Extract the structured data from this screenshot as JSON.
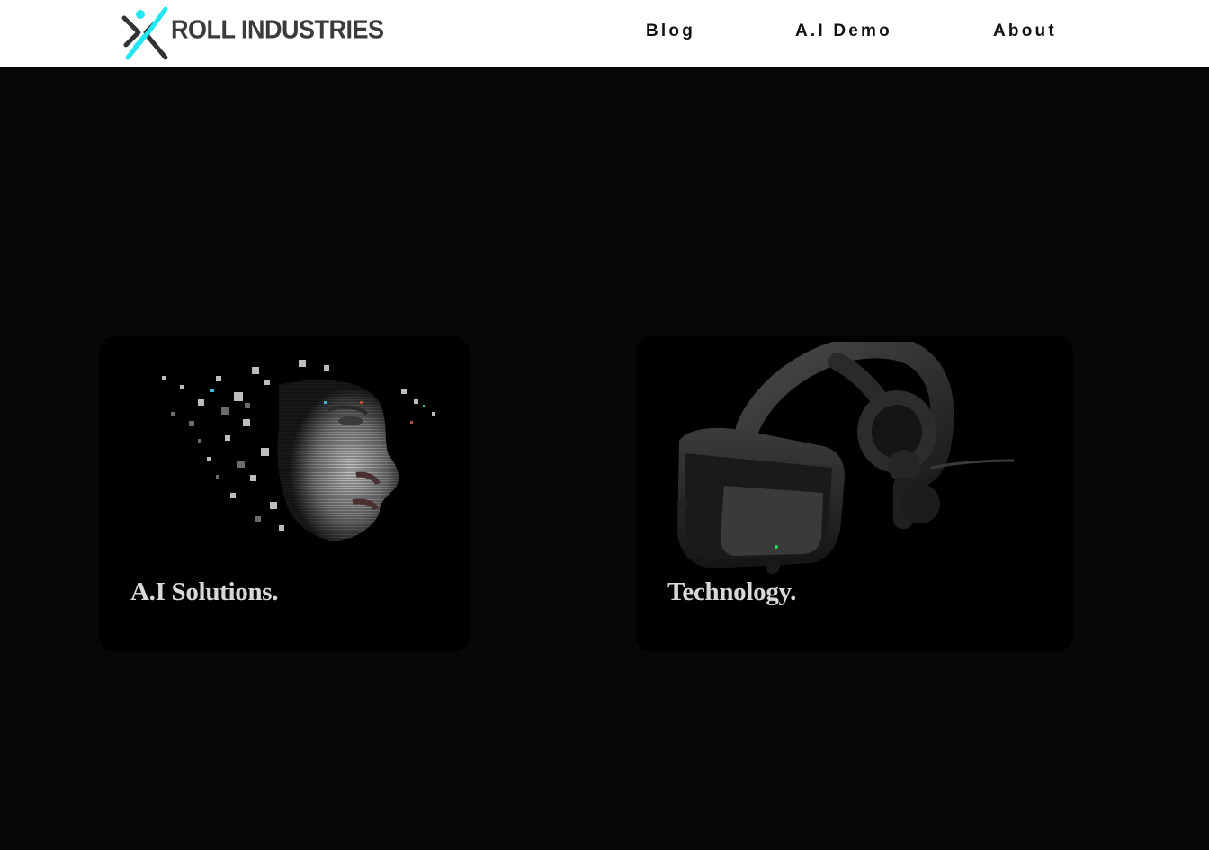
{
  "header": {
    "brand": "ROLL INDUSTRIES",
    "logo_icon": "runner-x-logo-icon",
    "colors": {
      "background": "#ffffff",
      "logo_accent": "#22e6f0",
      "logo_text": "#3b3b3b",
      "nav_text": "#111111"
    }
  },
  "nav": {
    "items": [
      {
        "label": "Blog"
      },
      {
        "label": "A.I Demo"
      },
      {
        "label": "About"
      }
    ]
  },
  "main": {
    "background": "#070707",
    "cards": [
      {
        "title": "A.I Solutions.",
        "image": "pixelated-face-image"
      },
      {
        "title": "Technology.",
        "image": "vr-headset-image"
      }
    ]
  }
}
